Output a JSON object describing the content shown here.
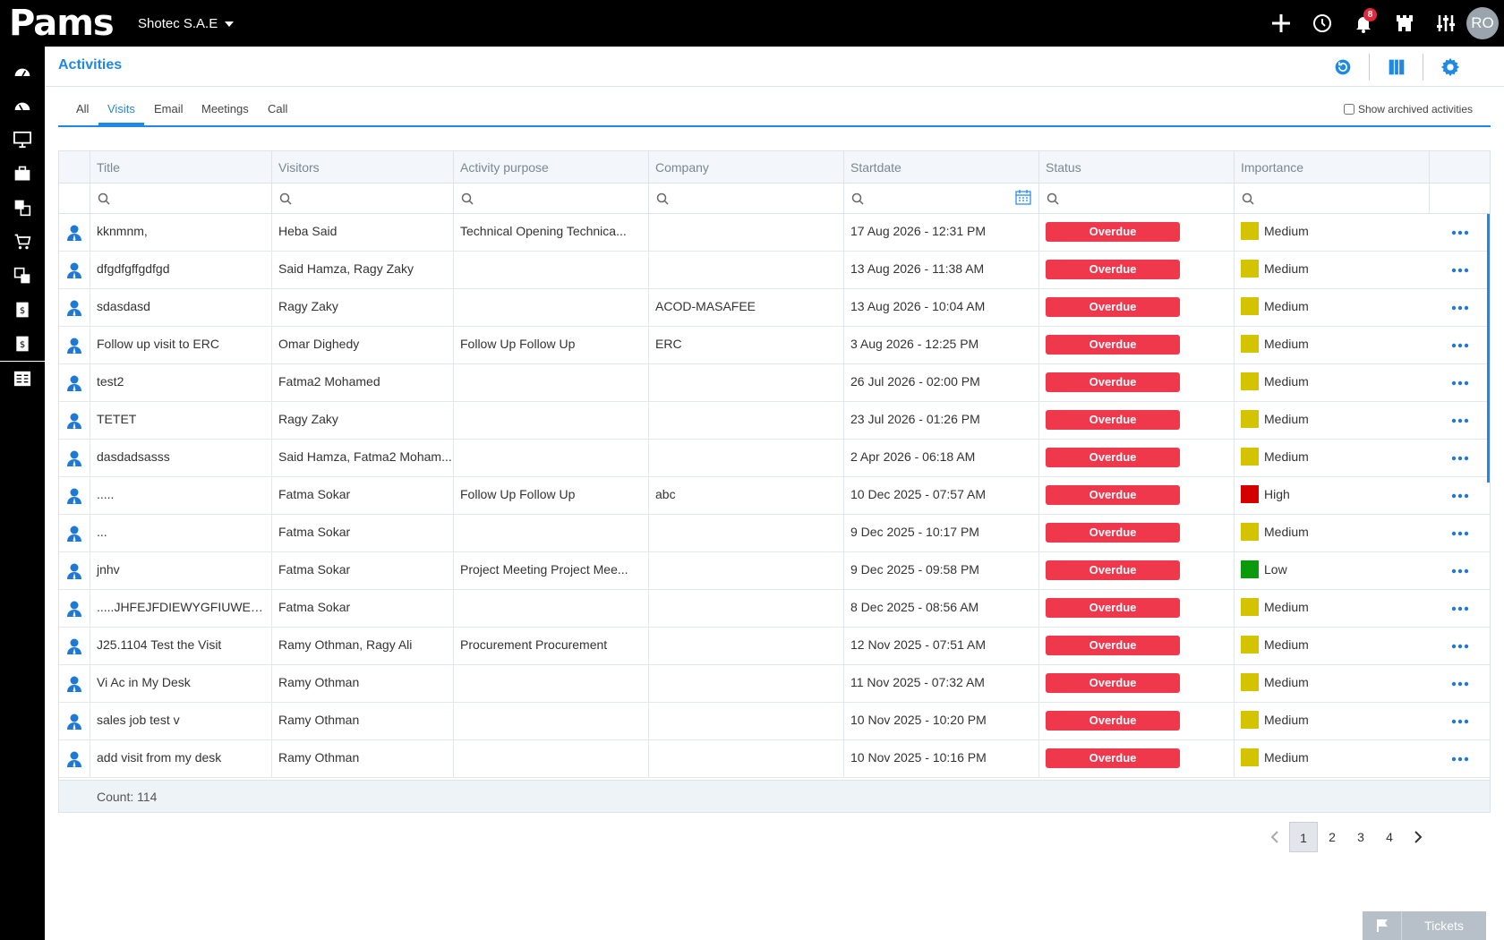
{
  "app": {
    "logo": "Pams",
    "company": "Shotec S.A.E",
    "notifications_count": "8",
    "user_initials": "RO"
  },
  "page": {
    "title": "Activities"
  },
  "tabs": [
    {
      "label": "All",
      "active": false
    },
    {
      "label": "Visits",
      "active": true
    },
    {
      "label": "Email",
      "active": false
    },
    {
      "label": "Meetings",
      "active": false
    },
    {
      "label": "Call",
      "active": false
    }
  ],
  "archived_label": "Show archived activities",
  "columns": [
    "Title",
    "Visitors",
    "Activity purpose",
    "Company",
    "Startdate",
    "Status",
    "Importance"
  ],
  "rows": [
    {
      "title": "kknmnm,",
      "visitors": "Heba Said",
      "purpose": "Technical Opening Technica...",
      "company": "",
      "start": "17 Aug 2026 - 12:31 PM",
      "status": "Overdue",
      "importance": "Medium"
    },
    {
      "title": "dfgdfgffgdfgd",
      "visitors": "Said Hamza, Ragy Zaky",
      "purpose": "",
      "company": "",
      "start": "13 Aug 2026 - 11:38 AM",
      "status": "Overdue",
      "importance": "Medium"
    },
    {
      "title": "sdasdasd",
      "visitors": "Ragy Zaky",
      "purpose": "",
      "company": "ACOD-MASAFEE",
      "start": "13 Aug 2026 - 10:04 AM",
      "status": "Overdue",
      "importance": "Medium"
    },
    {
      "title": "Follow up visit to ERC",
      "visitors": "Omar Dighedy",
      "purpose": "Follow Up Follow Up",
      "company": "ERC",
      "start": "3 Aug 2026 - 12:25 PM",
      "status": "Overdue",
      "importance": "Medium"
    },
    {
      "title": "test2",
      "visitors": "Fatma2 Mohamed",
      "purpose": "",
      "company": "",
      "start": "26 Jul 2026 - 02:00 PM",
      "status": "Overdue",
      "importance": "Medium"
    },
    {
      "title": "TETET",
      "visitors": "Ragy Zaky",
      "purpose": "",
      "company": "",
      "start": "23 Jul 2026 - 01:26 PM",
      "status": "Overdue",
      "importance": "Medium"
    },
    {
      "title": "dasdadsasss",
      "visitors": "Said Hamza, Fatma2 Moham...",
      "purpose": "",
      "company": "",
      "start": "2 Apr 2026 - 06:18 AM",
      "status": "Overdue",
      "importance": "Medium"
    },
    {
      "title": ".....",
      "visitors": "Fatma Sokar",
      "purpose": "Follow Up Follow Up",
      "company": "abc",
      "start": "10 Dec 2025 - 07:57 AM",
      "status": "Overdue",
      "importance": "High"
    },
    {
      "title": "...",
      "visitors": "Fatma Sokar",
      "purpose": "",
      "company": "",
      "start": "9 Dec 2025 - 10:17 PM",
      "status": "Overdue",
      "importance": "Medium"
    },
    {
      "title": "jnhv",
      "visitors": "Fatma Sokar",
      "purpose": "Project Meeting Project Mee...",
      "company": "",
      "start": "9 Dec 2025 - 09:58 PM",
      "status": "Overdue",
      "importance": "Low"
    },
    {
      "title": ".....JHFEJFDIEWYGFIUWEGKFGI",
      "visitors": "Fatma Sokar",
      "purpose": "",
      "company": "",
      "start": "8 Dec 2025 - 08:56 AM",
      "status": "Overdue",
      "importance": "Medium"
    },
    {
      "title": "J25.1104 Test the Visit",
      "visitors": "Ramy Othman, Ragy Ali",
      "purpose": "Procurement Procurement",
      "company": "",
      "start": "12 Nov 2025 - 07:51 AM",
      "status": "Overdue",
      "importance": "Medium"
    },
    {
      "title": "Vi Ac in My Desk",
      "visitors": "Ramy Othman",
      "purpose": "",
      "company": "",
      "start": "11 Nov 2025 - 07:32 AM",
      "status": "Overdue",
      "importance": "Medium"
    },
    {
      "title": "sales job test v",
      "visitors": "Ramy Othman",
      "purpose": "",
      "company": "",
      "start": "10 Nov 2025 - 10:20 PM",
      "status": "Overdue",
      "importance": "Medium"
    },
    {
      "title": "add visit from my desk",
      "visitors": "Ramy Othman",
      "purpose": "",
      "company": "",
      "start": "10 Nov 2025 - 10:16 PM",
      "status": "Overdue",
      "importance": "Medium"
    }
  ],
  "importance_colors": {
    "Medium": "#d4c400",
    "High": "#d40000",
    "Low": "#0b9a0b"
  },
  "status_color": "#f0384d",
  "accent_color": "#1e88e5",
  "count_label": "Count: 114",
  "pagination": {
    "pages": [
      "1",
      "2",
      "3",
      "4"
    ],
    "current": "1"
  },
  "tickets_label": "Tickets"
}
